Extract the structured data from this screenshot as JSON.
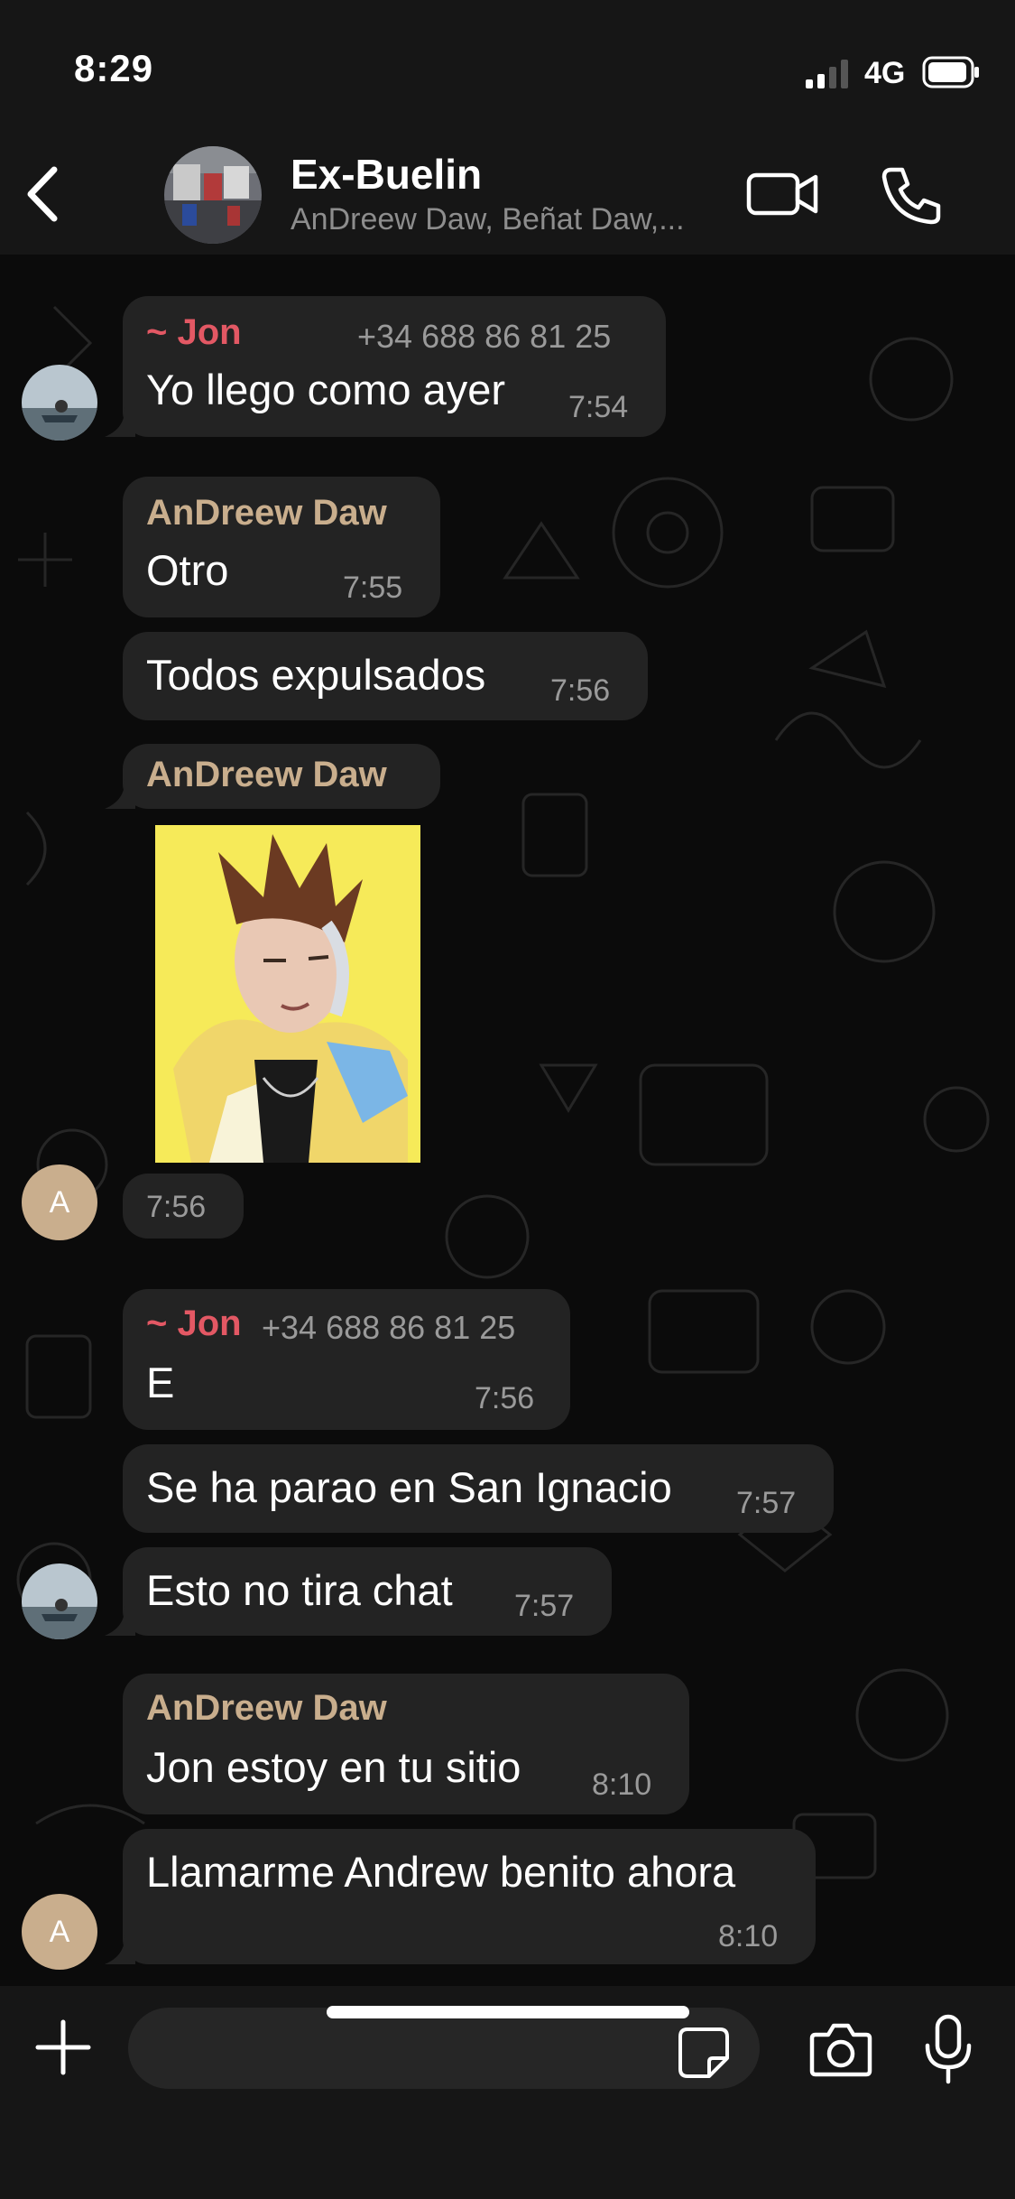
{
  "status": {
    "time": "8:29",
    "network": "4G"
  },
  "header": {
    "title": "Ex-Buelin",
    "subtitle": "AnDreew Daw, Beñat Daw,..."
  },
  "colors": {
    "jon": "#e35864",
    "andreew": "#c9ae8d",
    "bubble": "#232323",
    "bg": "#0b0b0b"
  },
  "messages": {
    "m1": {
      "sender": "~ Jon",
      "phone": "+34 688 86 81 25",
      "text": "Yo llego como ayer",
      "time": "7:54"
    },
    "m2": {
      "sender": "AnDreew Daw",
      "text": "Otro",
      "time": "7:55"
    },
    "m3": {
      "text": "Todos expulsados",
      "time": "7:56"
    },
    "m4": {
      "sender": "AnDreew Daw",
      "sticker": "cartoon-man-portrait",
      "time": "7:56"
    },
    "m5": {
      "sender": "~ Jon",
      "phone": "+34 688 86 81 25",
      "text": "E",
      "time": "7:56"
    },
    "m6": {
      "text": "Se ha parao en San Ignacio",
      "time": "7:57"
    },
    "m7": {
      "text": "Esto no tira chat",
      "time": "7:57"
    },
    "m8": {
      "sender": "AnDreew Daw",
      "text": "Jon estoy en tu sitio",
      "time": "8:10"
    },
    "m9": {
      "text": "Llamarme Andrew benito ahora",
      "time": "8:10"
    }
  },
  "avatars": {
    "andreew_letter": "A"
  },
  "icons": [
    "back-icon",
    "video-call-icon",
    "phone-call-icon",
    "plus-icon",
    "sticker-icon",
    "camera-icon",
    "microphone-icon"
  ]
}
